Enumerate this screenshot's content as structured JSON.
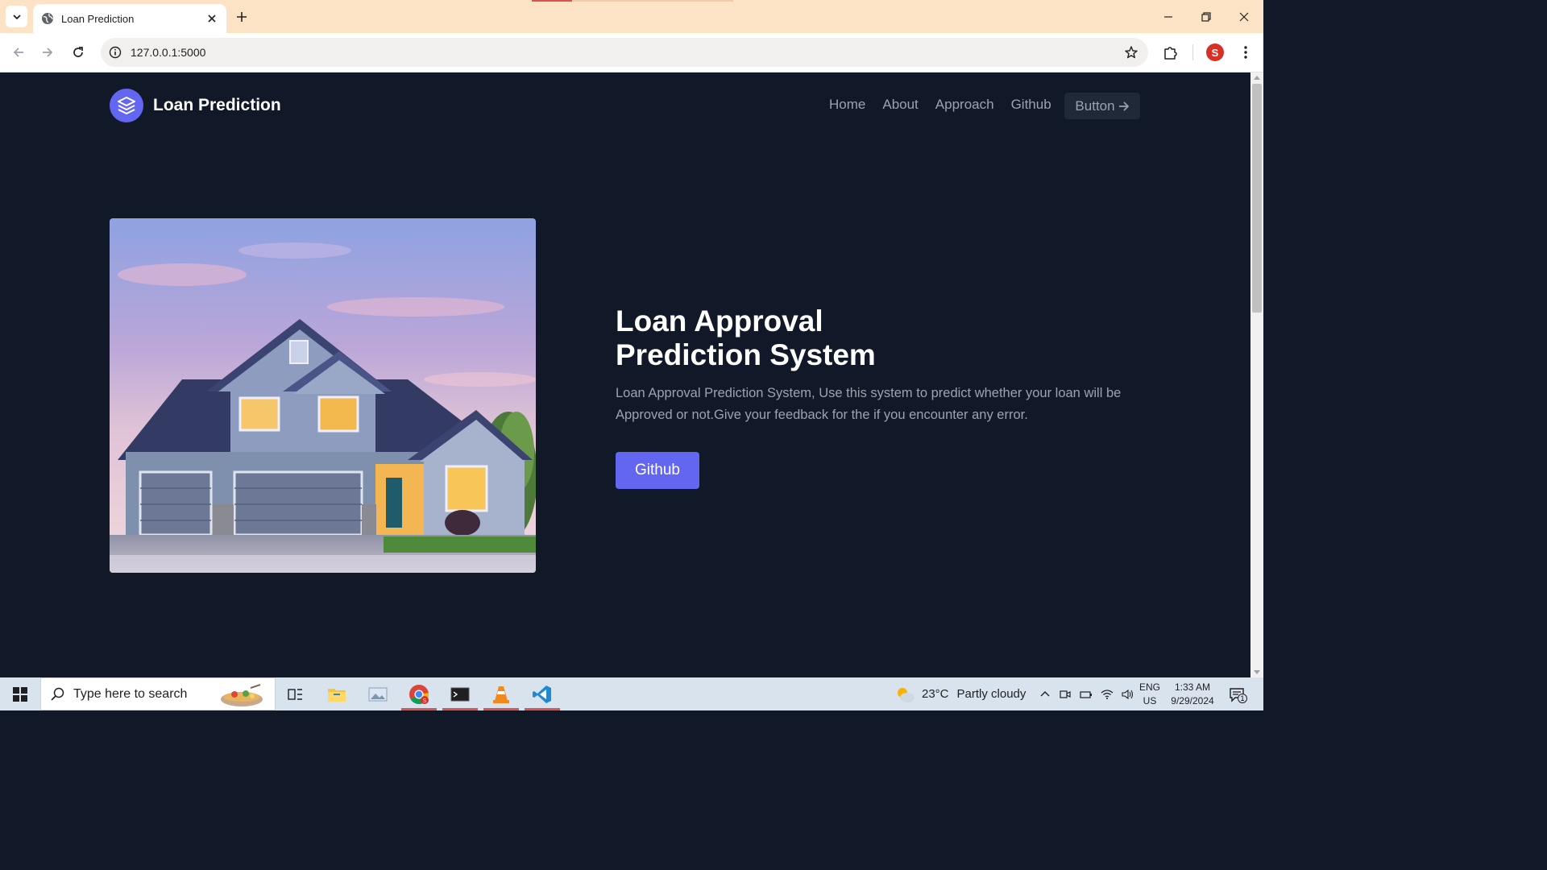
{
  "browser": {
    "tab_title": "Loan Prediction",
    "url": "127.0.0.1:5000",
    "profile_initial": "S"
  },
  "page": {
    "brand": "Loan Prediction",
    "nav": [
      "Home",
      "About",
      "Approach",
      "Github"
    ],
    "nav_button": "Button",
    "hero_title": "Loan Approval Prediction System",
    "hero_text": "Loan Approval Prediction System, Use this system to predict whether your loan will be Approved or not.Give your feedback for the if you encounter any error.",
    "cta_label": "Github",
    "accent_color": "#6366f1",
    "background_color": "#111827"
  },
  "taskbar": {
    "search_placeholder": "Type here to search",
    "weather_temp": "23°C",
    "weather_desc": "Partly cloudy",
    "lang_line1": "ENG",
    "lang_line2": "US",
    "time": "1:33 AM",
    "date": "9/29/2024",
    "notification_count": "1",
    "apps": [
      "task-view",
      "file-explorer",
      "photos",
      "chrome",
      "terminal",
      "vlc",
      "vscode"
    ]
  }
}
